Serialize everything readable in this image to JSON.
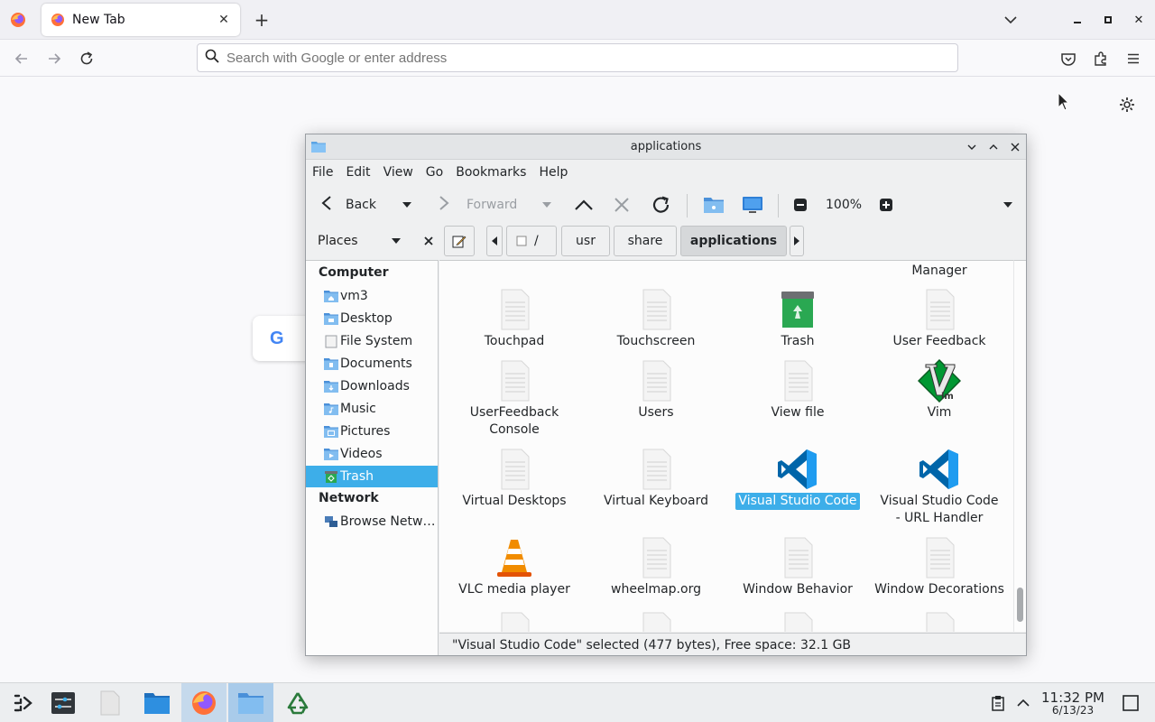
{
  "browser": {
    "tab_title": "New Tab",
    "url_placeholder": "Search with Google or enter address",
    "google_letter": "G"
  },
  "window": {
    "title": "applications",
    "menu": [
      "File",
      "Edit",
      "View",
      "Go",
      "Bookmarks",
      "Help"
    ],
    "toolbar": {
      "back_label": "Back",
      "forward_label": "Forward",
      "zoom_level": "100%"
    },
    "places_label": "Places",
    "breadcrumb": [
      "/",
      "usr",
      "share",
      "applications"
    ],
    "places": {
      "computer_label": "Computer",
      "computer_items": [
        "vm3",
        "Desktop",
        "File System",
        "Documents",
        "Downloads",
        "Music",
        "Pictures",
        "Videos",
        "Trash"
      ],
      "network_label": "Network",
      "network_items": [
        "Browse Netw…"
      ],
      "selected_item": "Trash"
    },
    "files": {
      "partial_top_label": "Manager",
      "rows": [
        [
          "Touchpad",
          "Touchscreen",
          "Trash",
          "User Feedback"
        ],
        [
          "UserFeedback Console",
          "Users",
          "View file",
          "Vim"
        ],
        [
          "Virtual Desktops",
          "Virtual Keyboard",
          "Visual Studio Code",
          "Visual Studio Code - URL Handler"
        ],
        [
          "VLC media player",
          "wheelmap.org",
          "Window Behavior",
          "Window Decorations"
        ]
      ],
      "selected_file": "Visual Studio Code"
    },
    "status_text": "\"Visual Studio Code\" selected (477 bytes), Free space: 32.1 GB"
  },
  "taskbar": {
    "clock_time": "11:32 PM",
    "clock_date": "6/13/23"
  },
  "colors": {
    "selection": "#3daee9",
    "vscode_blue": "#0065a9",
    "vlc_orange": "#f18c00",
    "vim_green": "#019833",
    "trash_green": "#2aa852"
  }
}
